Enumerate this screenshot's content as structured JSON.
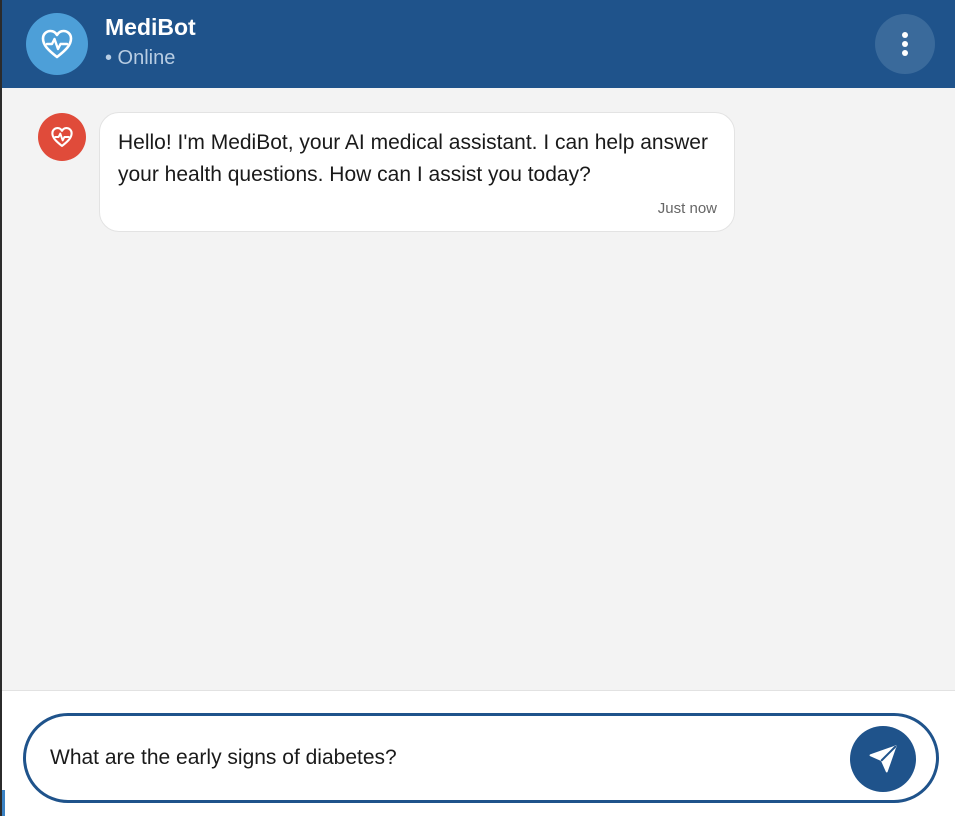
{
  "header": {
    "title": "MediBot",
    "status": "• Online",
    "avatar_icon": "heart-pulse-icon",
    "menu_icon": "more-vertical-icon"
  },
  "messages": [
    {
      "sender": "bot",
      "avatar_icon": "heart-pulse-icon",
      "text": "Hello! I'm MediBot, your AI medical assistant. I can help answer your health questions. How can I assist you today?",
      "time": "Just now"
    }
  ],
  "composer": {
    "value": "What are the early signs of diabetes?",
    "send_icon": "send-icon"
  },
  "colors": {
    "primary": "#1f538b",
    "header_avatar": "#4d9fd8",
    "bot_avatar": "#e04b3a",
    "chat_background": "#f3f3f3"
  }
}
